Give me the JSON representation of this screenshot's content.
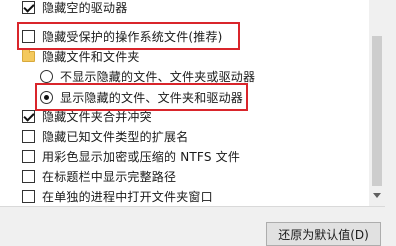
{
  "options_list": {
    "items": [
      {
        "type": "checkbox",
        "checked": true,
        "label": "隐藏空的驱动器"
      },
      {
        "type": "checkbox",
        "checked": false,
        "label": "隐藏受保护的操作系统文件(推荐)"
      },
      {
        "type": "folder",
        "label": "隐藏文件和文件夹"
      },
      {
        "type": "radio",
        "checked": false,
        "label": "不显示隐藏的文件、文件夹或驱动器"
      },
      {
        "type": "radio",
        "checked": true,
        "label": "显示隐藏的文件、文件夹和驱动器"
      },
      {
        "type": "checkbox",
        "checked": true,
        "label": "隐藏文件夹合并冲突"
      },
      {
        "type": "checkbox",
        "checked": false,
        "label": "隐藏已知文件类型的扩展名"
      },
      {
        "type": "checkbox",
        "checked": false,
        "label": "用彩色显示加密或压缩的 NTFS 文件"
      },
      {
        "type": "checkbox",
        "checked": false,
        "label": "在标题栏中显示完整路径"
      },
      {
        "type": "checkbox",
        "checked": false,
        "label": "在单独的进程中打开文件夹窗口"
      }
    ]
  },
  "buttons": {
    "restore_defaults": "还原为默认值(D)"
  },
  "colors": {
    "highlight": "#d9252b",
    "list_background": "#ffffff",
    "window_background": "#f0f0f0"
  }
}
